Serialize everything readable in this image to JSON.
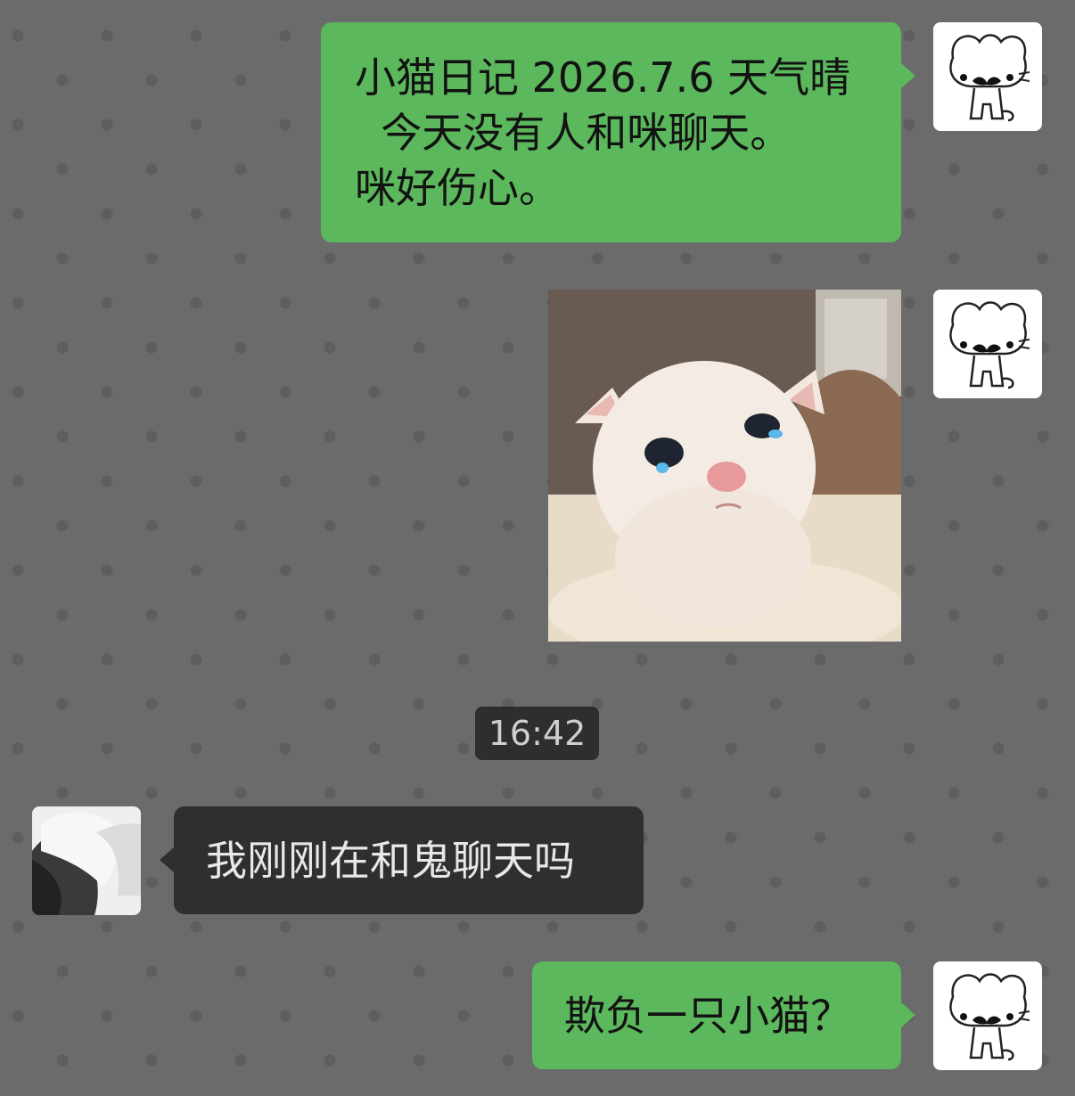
{
  "messages": [
    {
      "side": "right",
      "lines": [
        "小猫日记 2026.7.6 天气晴",
        "  今天没有人和咪聊天。",
        "咪好伤心。"
      ]
    },
    {
      "side": "right",
      "image": "crying-kitten-photo"
    },
    {
      "timestamp": "16:42"
    },
    {
      "side": "left",
      "text": "我刚刚在和鬼聊天吗"
    },
    {
      "side": "right",
      "text": "欺负一只小猫？"
    }
  ],
  "colors": {
    "background": "#6b6b6b",
    "mine_bubble": "#5cb85c",
    "theirs_bubble": "#2f2f2f",
    "timestamp_pill": "#2e2e2e"
  },
  "icons": {
    "my_avatar": "mustache-cat-avatar",
    "their_avatar": "grayscale-person-avatar"
  }
}
